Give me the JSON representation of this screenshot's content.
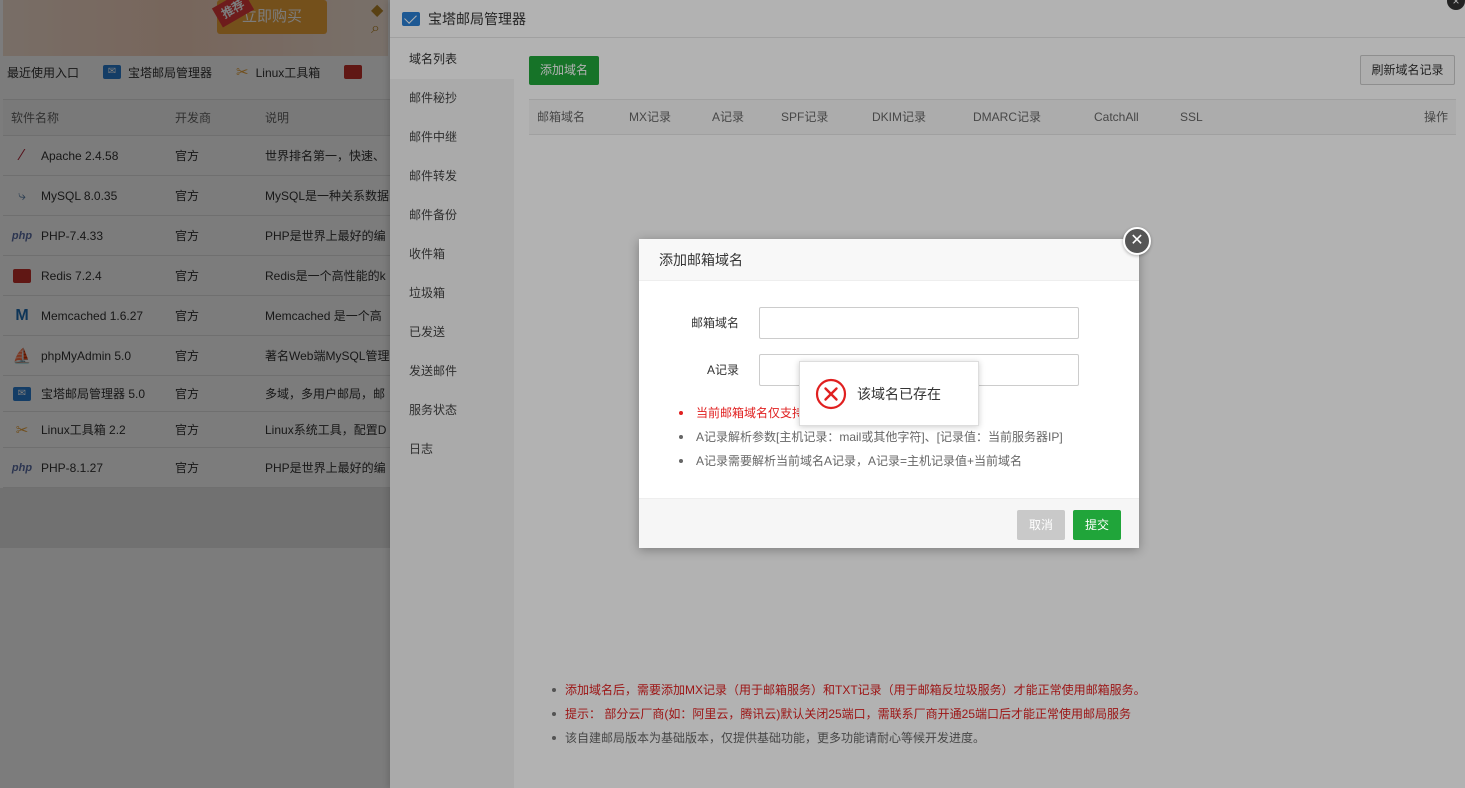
{
  "background": {
    "promo_tag": "推荐",
    "promo_button": "立即购买",
    "recent_title": "最近使用入口",
    "recent_items": [
      {
        "label": "宝塔邮局管理器",
        "icon": "mail-icon"
      },
      {
        "label": "Linux工具箱",
        "icon": "tools-icon"
      },
      {
        "label": "",
        "icon": "redis-icon"
      }
    ],
    "table_headers": [
      "软件名称",
      "开发商",
      "说明"
    ],
    "rows": [
      {
        "name": "Apache 2.4.58",
        "vendor": "官方",
        "desc": "世界排名第一，快速、",
        "icon": "apache-feather-icon"
      },
      {
        "name": "MySQL 8.0.35",
        "vendor": "官方",
        "desc": "MySQL是一种关系数据",
        "icon": "mysql-dolphin-icon"
      },
      {
        "name": "PHP-7.4.33",
        "vendor": "官方",
        "desc": "PHP是世界上最好的编",
        "icon": "php-icon"
      },
      {
        "name": "Redis 7.2.4",
        "vendor": "官方",
        "desc": "Redis是一个高性能的k",
        "icon": "redis-icon"
      },
      {
        "name": "Memcached 1.6.27",
        "vendor": "官方",
        "desc": "Memcached 是一个高",
        "icon": "memcached-icon"
      },
      {
        "name": "phpMyAdmin 5.0",
        "vendor": "官方",
        "desc": "著名Web端MySQL管理",
        "icon": "phpmyadmin-icon"
      },
      {
        "name": "宝塔邮局管理器 5.0",
        "vendor": "官方",
        "desc": "多域，多用户邮局，邮",
        "icon": "mail-icon"
      },
      {
        "name": "Linux工具箱 2.2",
        "vendor": "官方",
        "desc": "Linux系统工具，配置D",
        "icon": "tools-icon"
      },
      {
        "name": "PHP-8.1.27",
        "vendor": "官方",
        "desc": "PHP是世界上最好的编",
        "icon": "php-icon"
      }
    ]
  },
  "panel": {
    "title": "宝塔邮局管理器",
    "sidebar": [
      "域名列表",
      "邮件秘抄",
      "邮件中继",
      "邮件转发",
      "邮件备份",
      "收件箱",
      "垃圾箱",
      "已发送",
      "发送邮件",
      "服务状态",
      "日志"
    ],
    "active_index": 0,
    "add_domain_button": "添加域名",
    "refresh_button": "刷新域名记录",
    "table_headers": [
      "邮箱域名",
      "MX记录",
      "A记录",
      "SPF记录",
      "DKIM记录",
      "DMARC记录",
      "CatchAll",
      "SSL",
      "操作"
    ],
    "notes": [
      {
        "text": "添加域名后，需要添加MX记录（用于邮箱服务）和TXT记录（用于邮箱反垃圾服务）才能正常使用邮箱服务。",
        "color": "red"
      },
      {
        "text": "提示： 部分云厂商(如：阿里云，腾讯云)默认关闭25端口，需联系厂商开通25端口后才能正常使用邮局服务",
        "color": "red"
      },
      {
        "text": "该自建邮局版本为基础版本，仅提供基础功能，更多功能请耐心等候开发进度。",
        "color": "gray"
      }
    ]
  },
  "modal": {
    "title": "添加邮箱域名",
    "close_icon": "close-icon",
    "domain_label": "邮箱域名",
    "domain_value": "",
    "a_label": "A记录",
    "a_value": "",
    "tips": [
      {
        "text": "当前邮箱域名仅支持",
        "color": "red"
      },
      {
        "text": "A记录解析参数[主机记录：mail或其他字符]、[记录值：当前服务器IP]",
        "color": "gray"
      },
      {
        "text": "A记录需要解析当前域名A记录，A记录=主机记录值+当前域名",
        "color": "gray"
      }
    ],
    "cancel_button": "取消",
    "submit_button": "提交"
  },
  "toast": {
    "message": "该域名已存在",
    "icon": "error-circle-icon"
  },
  "colors": {
    "primary_green": "#20a53a",
    "error_red": "#e02020"
  }
}
